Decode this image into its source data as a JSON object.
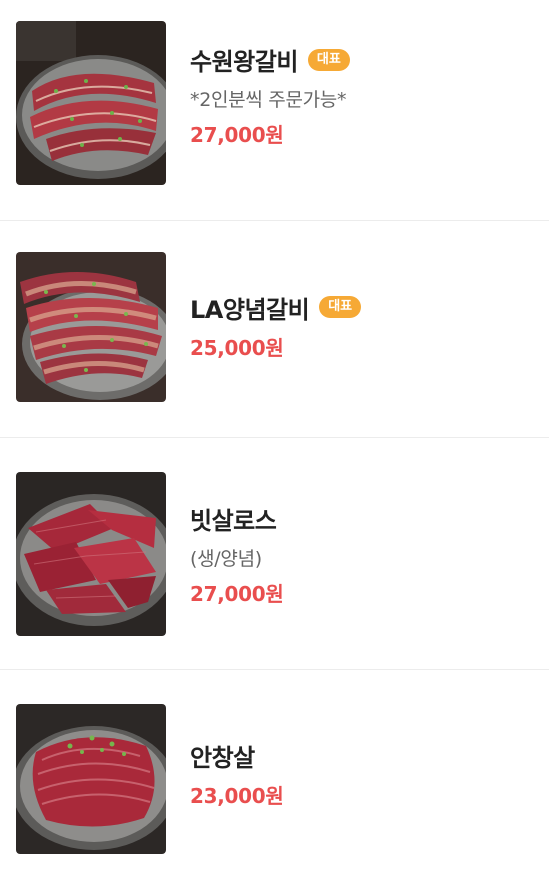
{
  "menu": {
    "items": [
      {
        "name": "수원왕갈비",
        "badge": "대표",
        "desc": "*2인분씩 주문가능*",
        "price": "27,000원",
        "image": "galbi-plate"
      },
      {
        "name": "LA양념갈비",
        "badge": "대표",
        "desc": "",
        "price": "25,000원",
        "image": "la-galbi-plate"
      },
      {
        "name": "빗살로스",
        "badge": "",
        "desc": "(생/양념)",
        "price": "27,000원",
        "image": "bitsal-plate"
      },
      {
        "name": "안창살",
        "badge": "",
        "desc": "",
        "price": "23,000원",
        "image": "anchangsal-plate"
      }
    ]
  },
  "colors": {
    "badge": "#f6a935",
    "price": "#e94e4e",
    "divider": "#ececec"
  }
}
